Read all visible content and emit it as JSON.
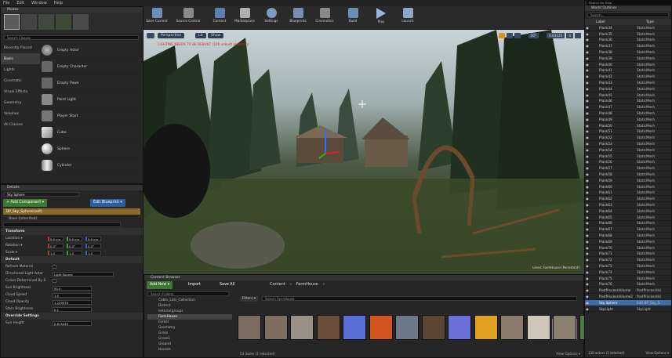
{
  "menu": [
    "File",
    "Edit",
    "Window",
    "Help"
  ],
  "search_help": "Search for Help",
  "modes": {
    "tab": "Modes",
    "search_placeholder": "Search Classes",
    "categories": [
      "Recently Placed",
      "Basic",
      "Lights",
      "Cinematic",
      "Visual Effects",
      "Geometry",
      "Volumes",
      "All Classes"
    ],
    "items": [
      "Empty Actor",
      "Empty Character",
      "Empty Pawn",
      "Point Light",
      "Player Start",
      "Cube",
      "Sphere",
      "Cylinder"
    ]
  },
  "toolbar": [
    "Save Current",
    "Source Control",
    "Content",
    "Marketplace",
    "Settings",
    "Blueprints",
    "Cinematics",
    "Build",
    "Play",
    "Launch"
  ],
  "viewport": {
    "perspective": "Perspective",
    "lit": "Lit",
    "show": "Show",
    "warning": "LIGHTING NEEDS TO BE REBUILT (100 unbuilt object(s))",
    "snap_angle": "10°",
    "snap_scale": "0.03125",
    "cam_speed": "4",
    "level": "Level: FarmHouse (Persistent)"
  },
  "details": {
    "tab": "Details",
    "name": "Sky Sphere",
    "add_component": "+ Add Component ▾",
    "edit_blueprint": "Edit Blueprint ▾",
    "component_self": "BP_Sky_Sphere(self)",
    "component_base": "Base (Inherited)",
    "transform_hdr": "Transform",
    "location": "Location ▾",
    "rotation": "Rotation ▾",
    "scale": "Scale ▾",
    "loc_values": [
      "0.0 cm",
      "0.0 cm",
      "0.0 cm"
    ],
    "rot_values": [
      "0.0°",
      "0.0°",
      "0.0°"
    ],
    "scale_values": [
      "1.0",
      "1.0",
      "1.0"
    ],
    "default_hdr": "Default",
    "refresh_material": "Refresh Material",
    "dir_light_actor": "Directional Light Actor",
    "dir_light_value": "Light Source",
    "colors_determined": "Colors Determined By S",
    "sun_brightness": "Sun Brightness",
    "sun_brightness_value": "50.0",
    "cloud_speed": "Cloud Speed",
    "cloud_speed_value": "1.0",
    "cloud_opacity": "Cloud Opacity",
    "cloud_opacity_value": "1.229379",
    "stars_brightness": "Stars Brightness",
    "stars_brightness_value": "0.1",
    "override_hdr": "Override Settings",
    "sun_height": "Sun Height",
    "sun_height_value": "0.615445"
  },
  "content_browser": {
    "tab": "Content Browser",
    "add_new": "Add New ▾",
    "import": "Import",
    "save_all": "Save All",
    "path": [
      "Content",
      "FarmHouse"
    ],
    "search_folders": "Search Folders",
    "filters": "Filters ▾",
    "search_farmhouse": "Search FarmHouse",
    "folders": [
      "Cabin_Lots_Collection",
      "District",
      "exteriorgroups",
      "FarmHouse",
      "Forest",
      "Geometry",
      "Grass",
      "Grass1",
      "Ground",
      "Houses"
    ],
    "selected_folder": "FarmHouse",
    "status": "53 items (1 selected)",
    "view_options": "View Options ▾",
    "tooltip": "Landscape Grass Type",
    "asset_colors": [
      "#7a6c5e",
      "#7e6f60",
      "#9a9186",
      "#6b4e3a",
      "#5a6ed8",
      "#d45520",
      "#6b7888",
      "#5b4636",
      "#6a70d8",
      "#e0a020",
      "#8a7c6a",
      "#cfc7b8",
      "#8a8070",
      "#4c7a4c"
    ]
  },
  "outliner": {
    "tab": "World Outliner",
    "search_placeholder": "Search...",
    "col_label": "Label",
    "col_type": "Type",
    "rows": [
      [
        "Plank34",
        "StaticMesh"
      ],
      [
        "Plank35",
        "StaticMesh"
      ],
      [
        "Plank36",
        "StaticMesh"
      ],
      [
        "Plank37",
        "StaticMesh"
      ],
      [
        "Plank38",
        "StaticMesh"
      ],
      [
        "Plank39",
        "StaticMesh"
      ],
      [
        "Plank40",
        "StaticMesh"
      ],
      [
        "Plank41",
        "StaticMesh"
      ],
      [
        "Plank42",
        "StaticMesh"
      ],
      [
        "Plank43",
        "StaticMesh"
      ],
      [
        "Plank44",
        "StaticMesh"
      ],
      [
        "Plank45",
        "StaticMesh"
      ],
      [
        "Plank46",
        "StaticMesh"
      ],
      [
        "Plank47",
        "StaticMesh"
      ],
      [
        "Plank48",
        "StaticMesh"
      ],
      [
        "Plank49",
        "StaticMesh"
      ],
      [
        "Plank50",
        "StaticMesh"
      ],
      [
        "Plank51",
        "StaticMesh"
      ],
      [
        "Plank52",
        "StaticMesh"
      ],
      [
        "Plank53",
        "StaticMesh"
      ],
      [
        "Plank54",
        "StaticMesh"
      ],
      [
        "Plank55",
        "StaticMesh"
      ],
      [
        "Plank56",
        "StaticMesh"
      ],
      [
        "Plank57",
        "StaticMesh"
      ],
      [
        "Plank58",
        "StaticMesh"
      ],
      [
        "Plank59",
        "StaticMesh"
      ],
      [
        "Plank60",
        "StaticMesh"
      ],
      [
        "Plank61",
        "StaticMesh"
      ],
      [
        "Plank62",
        "StaticMesh"
      ],
      [
        "Plank63",
        "StaticMesh"
      ],
      [
        "Plank64",
        "StaticMesh"
      ],
      [
        "Plank65",
        "StaticMesh"
      ],
      [
        "Plank66",
        "StaticMesh"
      ],
      [
        "Plank67",
        "StaticMesh"
      ],
      [
        "Plank68",
        "StaticMesh"
      ],
      [
        "Plank69",
        "StaticMesh"
      ],
      [
        "Plank70",
        "StaticMesh"
      ],
      [
        "Plank71",
        "StaticMesh"
      ],
      [
        "Plank72",
        "StaticMesh"
      ],
      [
        "Plank73",
        "StaticMesh"
      ],
      [
        "Plank74",
        "StaticMesh"
      ],
      [
        "Plank75",
        "StaticMesh"
      ],
      [
        "Plank76",
        "StaticMesh"
      ],
      [
        "PostProcessVolume",
        "PostProcessVol"
      ],
      [
        "PostProcessVolume2",
        "PostProcessVol"
      ],
      [
        "Sky Sphere",
        "Edit BP_Sky_S"
      ],
      [
        "SkyLight",
        "SkyLight"
      ]
    ],
    "selected_index": 45,
    "status": "130 actors (1 selected)",
    "view_options": "View Options ▾"
  }
}
